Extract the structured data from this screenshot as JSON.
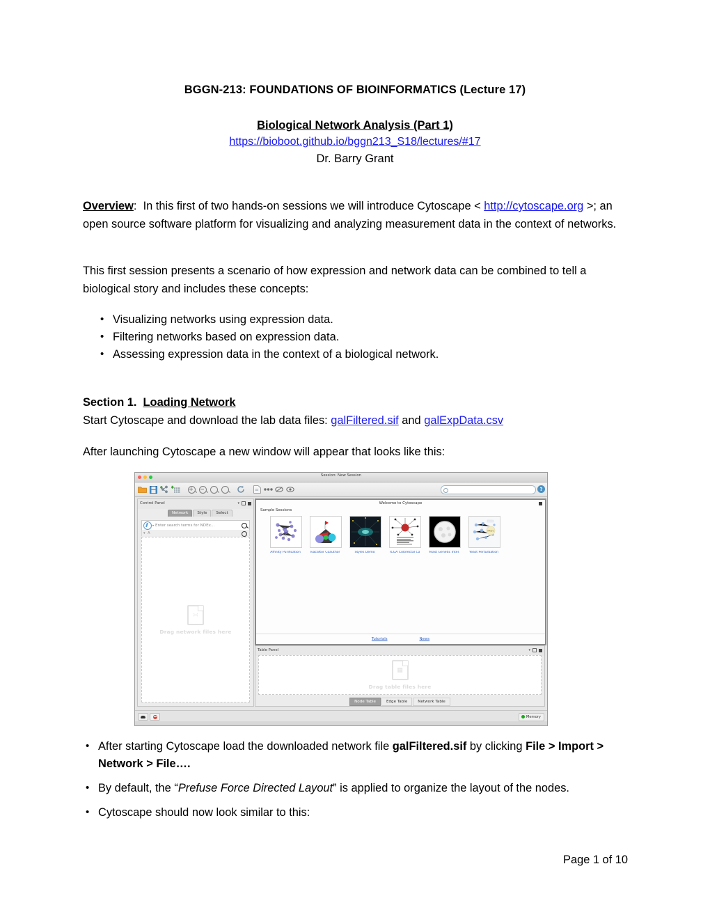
{
  "document": {
    "title": "BGGN-213: FOUNDATIONS OF BIOINFORMATICS (Lecture 17)",
    "subtitle": "Biological Network Analysis (Part 1)",
    "url": "https://bioboot.github.io/bggn213_S18/lectures/#17",
    "author": "Dr. Barry Grant",
    "footer": "Page 1 of 10"
  },
  "overview": {
    "label": "Overview",
    "colon": ":",
    "text_1": "In this first of two hands-on sessions we will introduce Cytoscape < ",
    "link": "http://cytoscape.org",
    "text_2": " >; an open source software platform for visualizing and analyzing measurement data in the context of networks."
  },
  "session_intro": "This first session presents a scenario of how expression and network data can be combined to tell a biological story and includes these concepts:",
  "concepts": [
    "Visualizing networks using expression data.",
    "Filtering networks based on expression data.",
    "Assessing expression data in the context of a biological network."
  ],
  "section1": {
    "number": "Section 1.",
    "heading": "Loading Network",
    "body_pre": "Start Cytoscape and download the lab data files:  ",
    "file_1": "galFiltered.sif",
    "and": " and ",
    "file_2": "galExpData.csv",
    "launch_text": "After launching Cytoscape a new window will appear that looks like this:"
  },
  "steps": {
    "step1_pre": "After starting Cytoscape load the downloaded network file ",
    "step1_file": "galFiltered.sif",
    "step1_mid": " by clicking ",
    "step1_menu": "File > Import > Network > File….",
    "step2_pre": "By default, the “",
    "step2_layout": "Prefuse Force Directed Layout",
    "step2_post": "” is applied to organize the layout of the nodes.",
    "step3": "Cytoscape should now look similar to this:"
  },
  "cytoscape": {
    "session_title": "Session: New Session",
    "control_panel": {
      "title": "Control Panel",
      "tabs": [
        "Network",
        "Style",
        "Select"
      ],
      "selected_tab": "Network",
      "ndex_placeholder": "Enter search terms for NDEx...",
      "dropzone_text": "Drag network files here"
    },
    "welcome": {
      "title": "Welcome to Cytoscape",
      "section_label": "Sample Sessions",
      "samples": [
        {
          "label": "Affinity Purification"
        },
        {
          "label": "Ivacaftor Coauthor"
        },
        {
          "label": "Styles Demo"
        },
        {
          "label": "TCGA Colorectal Can..."
        },
        {
          "label": "Yeast Genetic Interac..."
        },
        {
          "label": "Yeast Perturbation"
        }
      ],
      "links": [
        "Tutorials",
        "News"
      ]
    },
    "table_panel": {
      "title": "Table Panel",
      "dropzone_text": "Drag table files here",
      "tabs": [
        "Node Table",
        "Edge Table",
        "Network Table"
      ],
      "selected_tab": "Node Table"
    },
    "status": {
      "memory": "Memory"
    }
  },
  "colors": {
    "link": "#1a1aee",
    "cy_link": "#2b5fc4",
    "memory_ok": "#1aa81a"
  }
}
